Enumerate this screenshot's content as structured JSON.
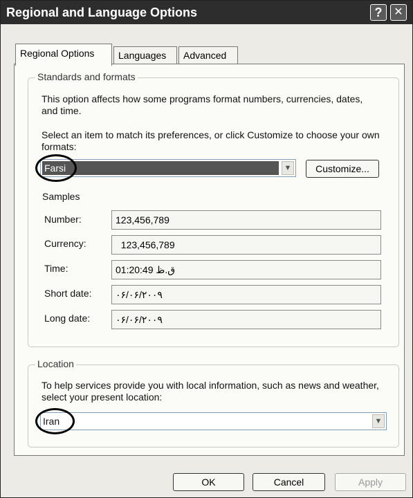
{
  "window": {
    "title": "Regional and Language Options",
    "help_glyph": "?",
    "close_glyph": "✕"
  },
  "tabs": [
    {
      "label": "Regional Options",
      "active": true
    },
    {
      "label": "Languages",
      "active": false
    },
    {
      "label": "Advanced",
      "active": false
    }
  ],
  "standards": {
    "group_label": "Standards and formats",
    "description": "This option affects how some programs format numbers, currencies, dates, and time.",
    "instruction": "Select an item to match its preferences, or click Customize to choose your own formats:",
    "selected_format": "Farsi",
    "customize_label": "Customize..."
  },
  "samples": {
    "heading": "Samples",
    "rows": [
      {
        "label": "Number:",
        "value": "123,456,789"
      },
      {
        "label": "Currency:",
        "value": "  123,456,789"
      },
      {
        "label": "Time:",
        "value": "01:20:49 ق.ظ"
      },
      {
        "label": "Short date:",
        "value": "۰۶/۰۶/۲۰۰۹"
      },
      {
        "label": "Long date:",
        "value": "۰۶/۰۶/۲۰۰۹"
      }
    ]
  },
  "location": {
    "group_label": "Location",
    "description": "To help services provide you with local information, such as news and weather, select your present location:",
    "selected_location": "Iran"
  },
  "buttons": {
    "ok": "OK",
    "cancel": "Cancel",
    "apply": "Apply"
  },
  "colors": {
    "titlebar": "#2d2d2d",
    "dialog_bg": "#ecebe5",
    "highlight_bg": "#555555"
  }
}
